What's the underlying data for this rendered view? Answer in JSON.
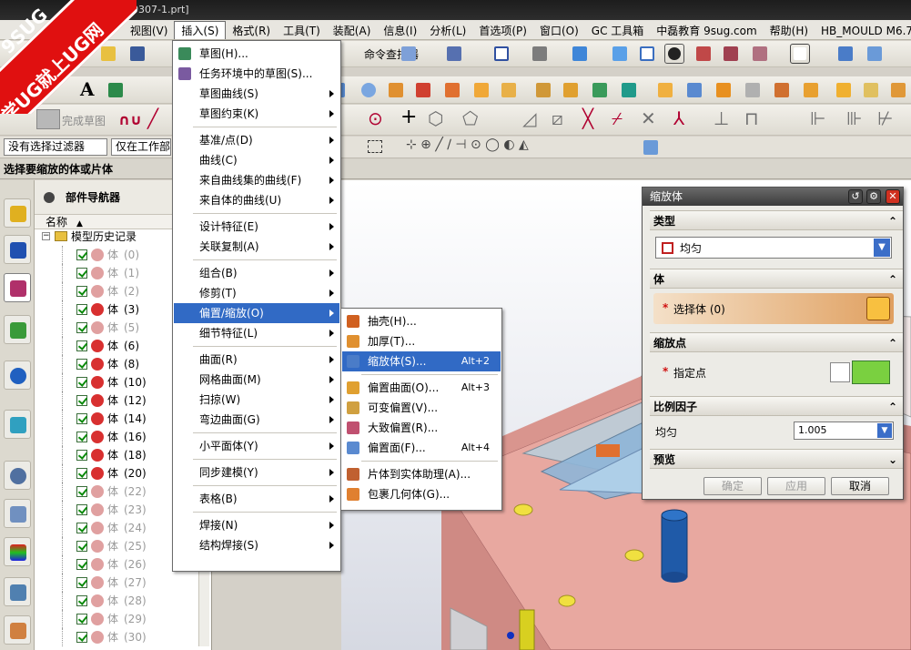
{
  "window": {
    "title": "0307-1.prt]"
  },
  "logo": {
    "line1": "9SUG",
    "line2": "学UG就上UG网"
  },
  "menubar": [
    "视图(V)",
    "插入(S)",
    "格式(R)",
    "工具(T)",
    "装配(A)",
    "信息(I)",
    "分析(L)",
    "首选项(P)",
    "窗口(O)",
    "GC 工具箱",
    "中磊教育 9sug.com",
    "帮助(H)",
    "HB_MOULD M6.7"
  ],
  "toolbar": {
    "command_finder": "命令查找器",
    "finish_sketch": "完成草图"
  },
  "filter": {
    "type_filter": "没有选择过滤器",
    "scope": "仅在工作部件"
  },
  "status": {
    "prompt": "选择要缩放的体或片体"
  },
  "navigator": {
    "title": "部件导航器",
    "col_name": "名称",
    "root": "模型历史记录",
    "body_label": "体",
    "items": [
      {
        "id": "(0)",
        "active": false
      },
      {
        "id": "(1)",
        "active": false
      },
      {
        "id": "(2)",
        "active": false
      },
      {
        "id": "(3)",
        "active": true
      },
      {
        "id": "(5)",
        "active": false
      },
      {
        "id": "(6)",
        "active": true
      },
      {
        "id": "(8)",
        "active": true
      },
      {
        "id": "(10)",
        "active": true
      },
      {
        "id": "(12)",
        "active": true
      },
      {
        "id": "(14)",
        "active": true
      },
      {
        "id": "(16)",
        "active": true
      },
      {
        "id": "(18)",
        "active": true
      },
      {
        "id": "(20)",
        "active": true
      },
      {
        "id": "(22)",
        "active": false
      },
      {
        "id": "(23)",
        "active": false
      },
      {
        "id": "(24)",
        "active": false
      },
      {
        "id": "(25)",
        "active": false
      },
      {
        "id": "(26)",
        "active": false
      },
      {
        "id": "(27)",
        "active": false
      },
      {
        "id": "(28)",
        "active": false
      },
      {
        "id": "(29)",
        "active": false
      },
      {
        "id": "(30)",
        "active": false
      }
    ]
  },
  "insert_menu": [
    {
      "label": "草图(H)...",
      "sub": false
    },
    {
      "label": "任务环境中的草图(S)...",
      "sub": false
    },
    {
      "label": "草图曲线(S)",
      "sub": true
    },
    {
      "label": "草图约束(K)",
      "sub": true
    },
    {
      "sep": true
    },
    {
      "label": "基准/点(D)",
      "sub": true
    },
    {
      "label": "曲线(C)",
      "sub": true
    },
    {
      "label": "来自曲线集的曲线(F)",
      "sub": true
    },
    {
      "label": "来自体的曲线(U)",
      "sub": true
    },
    {
      "sep": true
    },
    {
      "label": "设计特征(E)",
      "sub": true
    },
    {
      "label": "关联复制(A)",
      "sub": true
    },
    {
      "sep": true
    },
    {
      "label": "组合(B)",
      "sub": true
    },
    {
      "label": "修剪(T)",
      "sub": true
    },
    {
      "label": "偏置/缩放(O)",
      "sub": true,
      "highlight": true
    },
    {
      "label": "细节特征(L)",
      "sub": true
    },
    {
      "sep": true
    },
    {
      "label": "曲面(R)",
      "sub": true
    },
    {
      "label": "网格曲面(M)",
      "sub": true
    },
    {
      "label": "扫掠(W)",
      "sub": true
    },
    {
      "label": "弯边曲面(G)",
      "sub": true
    },
    {
      "sep": true
    },
    {
      "label": "小平面体(Y)",
      "sub": true
    },
    {
      "sep": true
    },
    {
      "label": "同步建模(Y)",
      "sub": true
    },
    {
      "sep": true
    },
    {
      "label": "表格(B)",
      "sub": true
    },
    {
      "sep": true
    },
    {
      "label": "焊接(N)",
      "sub": true
    },
    {
      "label": "结构焊接(S)",
      "sub": true
    }
  ],
  "offset_menu": [
    {
      "label": "抽壳(H)...",
      "shortcut": "",
      "color": "#d06020"
    },
    {
      "label": "加厚(T)...",
      "shortcut": "",
      "color": "#e09030"
    },
    {
      "label": "缩放体(S)...",
      "shortcut": "Alt+2",
      "color": "#4a7cc8",
      "highlight": true
    },
    {
      "sep": true
    },
    {
      "label": "偏置曲面(O)...",
      "shortcut": "Alt+3",
      "color": "#e0a030"
    },
    {
      "label": "可变偏置(V)...",
      "shortcut": "",
      "color": "#d0a040"
    },
    {
      "label": "大致偏置(R)...",
      "shortcut": "",
      "color": "#c05070"
    },
    {
      "label": "偏置面(F)...",
      "shortcut": "Alt+4",
      "color": "#5a8ad0"
    },
    {
      "sep": true
    },
    {
      "label": "片体到实体助理(A)...",
      "shortcut": "",
      "color": "#c06030"
    },
    {
      "label": "包裹几何体(G)...",
      "shortcut": "",
      "color": "#e08030"
    }
  ],
  "dialog": {
    "title": "缩放体",
    "sec_type": "类型",
    "type_value": "均匀",
    "sec_body": "体",
    "select_body": "选择体 (0)",
    "sec_point": "缩放点",
    "specify_point": "指定点",
    "sec_factor": "比例因子",
    "uniform_label": "均匀",
    "uniform_value": "1.005",
    "sec_preview": "预览",
    "ok": "确定",
    "apply": "应用",
    "cancel": "取消"
  },
  "colors": {
    "accent": "#316ac5",
    "menu_bg": "#ffffff",
    "dialog_bg": "#ecebe6",
    "selection_gradient": "#e0a060",
    "mold_pink": "#e8a8a0"
  }
}
